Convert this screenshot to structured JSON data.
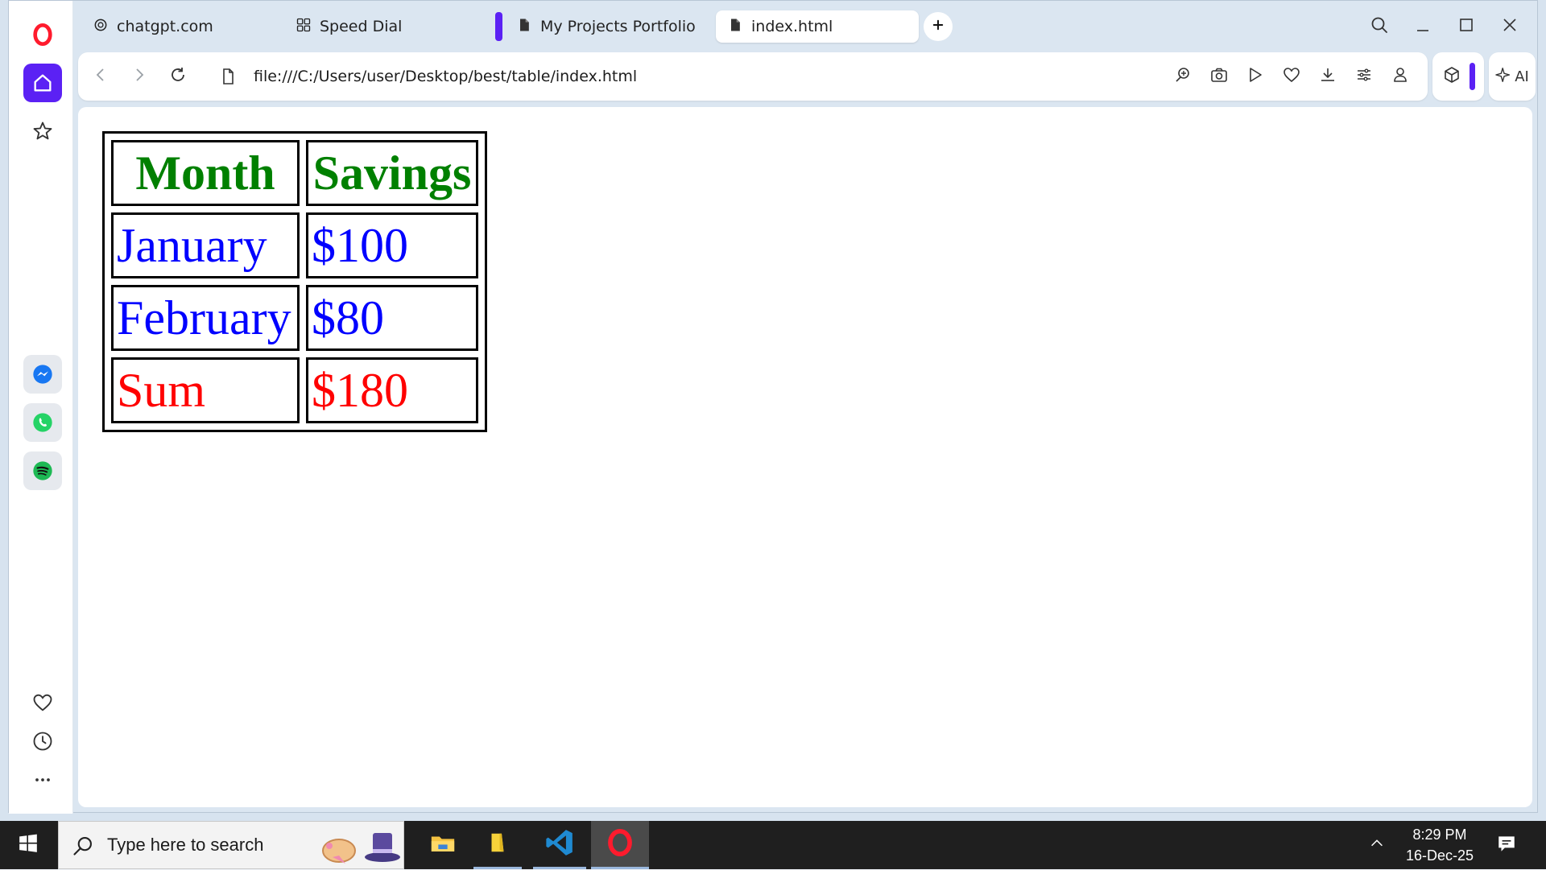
{
  "browser": {
    "tabs": [
      {
        "label": "chatgpt.com",
        "icon": "openai-icon"
      },
      {
        "label": "Speed Dial",
        "icon": "grid-icon"
      },
      {
        "label": "My Projects Portfolio",
        "icon": "document-icon"
      },
      {
        "label": "index.html",
        "icon": "document-icon",
        "active": true
      }
    ],
    "address": {
      "url": "file:///C:/Users/user/Desktop/best/table/index.html"
    },
    "ai_label": "AI"
  },
  "page": {
    "table": {
      "headers": [
        "Month",
        "Savings"
      ],
      "rows": [
        {
          "month": "January",
          "savings": "$100"
        },
        {
          "month": "February",
          "savings": "$80"
        },
        {
          "month": "Sum",
          "savings": "$180"
        }
      ],
      "colors": {
        "header": "#008000",
        "rows": "#0000ff",
        "sum": "#ff0000"
      }
    }
  },
  "taskbar": {
    "search_placeholder": "Type here to search",
    "time": "8:29 PM",
    "date": "16-Dec-25"
  },
  "colors": {
    "accent": "#5b21f4",
    "opera_red": "#ff1b2d"
  }
}
